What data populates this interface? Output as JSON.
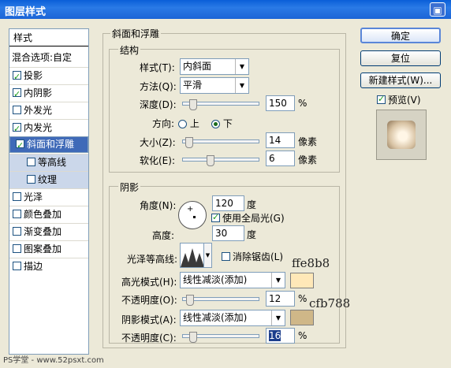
{
  "title": "图层样式",
  "close_icon": "▣",
  "styles_header": "样式",
  "blend_options": "混合选项:自定",
  "style_items": [
    {
      "label": "投影",
      "checked": true
    },
    {
      "label": "内阴影",
      "checked": true
    },
    {
      "label": "外发光",
      "checked": false
    },
    {
      "label": "内发光",
      "checked": true
    },
    {
      "label": "斜面和浮雕",
      "checked": true
    },
    {
      "label": "等高线",
      "checked": false
    },
    {
      "label": "纹理",
      "checked": false
    },
    {
      "label": "光泽",
      "checked": false
    },
    {
      "label": "颜色叠加",
      "checked": false
    },
    {
      "label": "渐变叠加",
      "checked": false
    },
    {
      "label": "图案叠加",
      "checked": false
    },
    {
      "label": "描边",
      "checked": false
    }
  ],
  "bevel": {
    "group_title": "斜面和浮雕",
    "structure_title": "结构",
    "style_label": "样式(T):",
    "style_value": "内斜面",
    "technique_label": "方法(Q):",
    "technique_value": "平滑",
    "depth_label": "深度(D):",
    "depth_value": "150",
    "depth_unit": "%",
    "direction_label": "方向:",
    "dir_up": "上",
    "dir_down": "下",
    "size_label": "大小(Z):",
    "size_value": "14",
    "size_unit": "像素",
    "soften_label": "软化(E):",
    "soften_value": "6",
    "soften_unit": "像素"
  },
  "shading": {
    "title": "阴影",
    "angle_label": "角度(N):",
    "angle_value": "120",
    "angle_unit": "度",
    "global_light": "使用全局光(G)",
    "altitude_label": "高度:",
    "altitude_value": "30",
    "altitude_unit": "度",
    "gloss_label": "光泽等高线:",
    "antialias": "消除锯齿(L)",
    "highlight_label": "高光模式(H):",
    "highlight_mode": "线性减淡(添加)",
    "highlight_color": "#ffe8b8",
    "highlight_opacity_label": "不透明度(O):",
    "highlight_opacity": "12",
    "shadow_label": "阴影模式(A):",
    "shadow_mode": "线性减淡(添加)",
    "shadow_color": "#cfb788",
    "shadow_opacity_label": "不透明度(C):",
    "shadow_opacity": "16",
    "percent": "%"
  },
  "annotations": {
    "highlight_hex": "ffe8b8",
    "shadow_hex": "cfb788"
  },
  "buttons": {
    "ok": "确定",
    "reset": "复位",
    "new_style": "新建样式(W)...",
    "preview": "预览(V)"
  },
  "watermark": "PS学堂 - www.52psxt.com"
}
